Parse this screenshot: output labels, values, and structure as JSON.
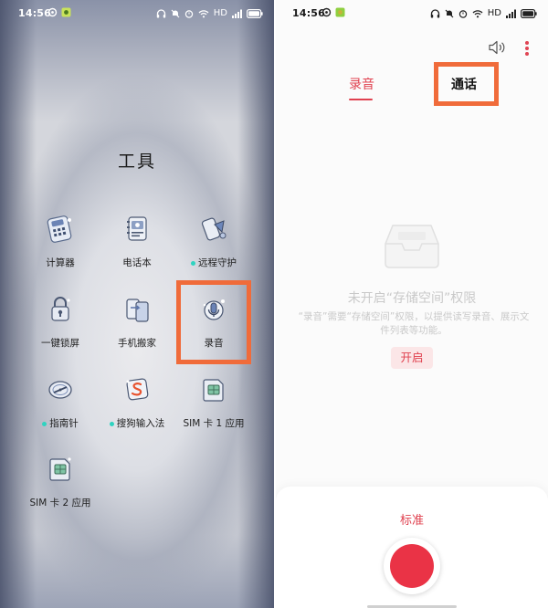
{
  "left_screen": {
    "status_bar": {
      "time": "14:56",
      "network": "HD"
    },
    "folder_title": "工具",
    "apps": [
      {
        "label": "计算器",
        "icon": "calculator-icon",
        "dot": false
      },
      {
        "label": "电话本",
        "icon": "phonebook-icon",
        "dot": false
      },
      {
        "label": "远程守护",
        "icon": "remote-guard-icon",
        "dot": true
      },
      {
        "label": "一键锁屏",
        "icon": "lock-screen-icon",
        "dot": false
      },
      {
        "label": "手机搬家",
        "icon": "phone-clone-icon",
        "dot": false
      },
      {
        "label": "录音",
        "icon": "recorder-icon",
        "dot": false
      },
      {
        "label": "指南针",
        "icon": "compass-icon",
        "dot": true
      },
      {
        "label": "搜狗输入法",
        "icon": "sogou-input-icon",
        "dot": true
      },
      {
        "label": "SIM 卡 1 应用",
        "icon": "sim1-app-icon",
        "dot": false
      },
      {
        "label": "SIM 卡 2 应用",
        "icon": "sim2-app-icon",
        "dot": false
      }
    ],
    "highlight_color": "#f06b3a"
  },
  "right_screen": {
    "status_bar": {
      "time": "14:56",
      "network": "HD"
    },
    "tabs": {
      "recording": "录音",
      "call": "通话"
    },
    "empty_state": {
      "title": "未开启“存储空间”权限",
      "description": "“录音”需要“存储空间”权限，以提供读写录音、展示文件列表等功能。",
      "button": "开启"
    },
    "mode_label": "标准",
    "accent_color": "#e0414f",
    "highlight_color": "#f06b3a"
  }
}
